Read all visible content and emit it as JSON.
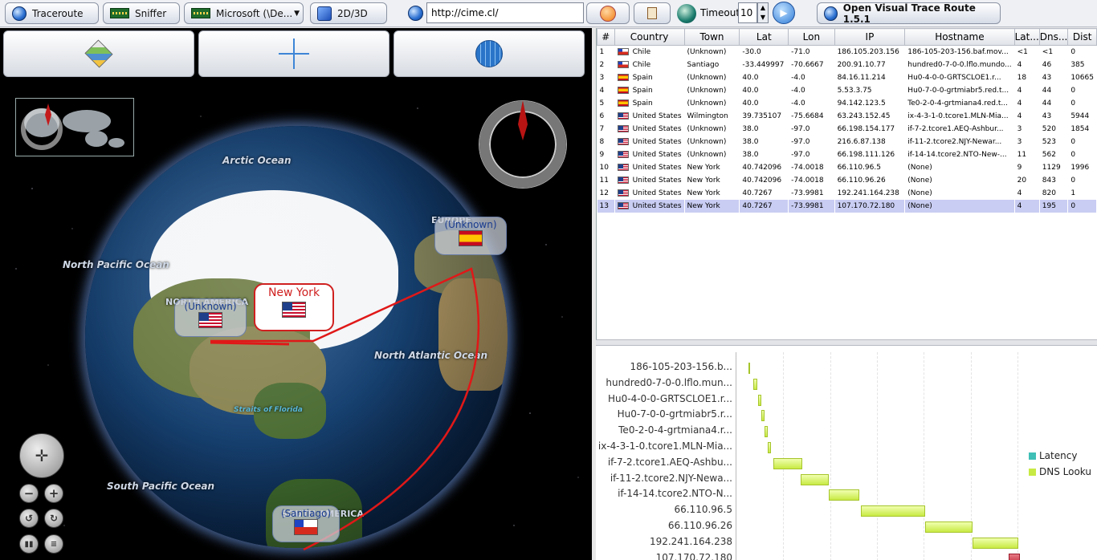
{
  "toolbar": {
    "traceroute_label": "Traceroute",
    "sniffer_label": "Sniffer",
    "interface_select": "Microsoft (\\De...",
    "view_toggle_label": "2D/3D",
    "url_value": "http://cime.cl/",
    "timeout_label": "Timeout",
    "timeout_value": "10",
    "app_title": "Open Visual Trace Route 1.5.1"
  },
  "map": {
    "ocean_labels": {
      "arctic": "Arctic Ocean",
      "north_pacific": "North Pacific Ocean",
      "north_atlantic": "North Atlantic Ocean",
      "south_pacific": "South Pacific Ocean",
      "straits": "Straits of Florida"
    },
    "region_labels": {
      "europe": "EUROPE",
      "north_america": "NORTH AMERICA",
      "south_america": "SOUTH AMERICA"
    },
    "callouts": {
      "spain": "(Unknown)",
      "us_unknown": "(Unknown)",
      "new_york": "New York",
      "santiago": "(Santiago)"
    }
  },
  "table": {
    "headers": [
      "#",
      "Country",
      "Town",
      "Lat",
      "Lon",
      "IP",
      "Hostname",
      "Lat...",
      "Dns...",
      "Dist"
    ],
    "rows": [
      {
        "n": "1",
        "country": "Chile",
        "town": "(Unknown)",
        "lat": "-30.0",
        "lon": "-71.0",
        "ip": "186.105.203.156",
        "host": "186-105-203-156.baf.mov...",
        "latency": "<1",
        "dns": "<1",
        "dist": "0"
      },
      {
        "n": "2",
        "country": "Chile",
        "town": "Santiago",
        "lat": "-33.449997",
        "lon": "-70.6667",
        "ip": "200.91.10.77",
        "host": "hundred0-7-0-0.lflo.mundo...",
        "latency": "4",
        "dns": "46",
        "dist": "385"
      },
      {
        "n": "3",
        "country": "Spain",
        "town": "(Unknown)",
        "lat": "40.0",
        "lon": "-4.0",
        "ip": "84.16.11.214",
        "host": "Hu0-4-0-0-GRTSCLOE1.r...",
        "latency": "18",
        "dns": "43",
        "dist": "10665"
      },
      {
        "n": "4",
        "country": "Spain",
        "town": "(Unknown)",
        "lat": "40.0",
        "lon": "-4.0",
        "ip": "5.53.3.75",
        "host": "Hu0-7-0-0-grtmiabr5.red.t...",
        "latency": "4",
        "dns": "44",
        "dist": "0"
      },
      {
        "n": "5",
        "country": "Spain",
        "town": "(Unknown)",
        "lat": "40.0",
        "lon": "-4.0",
        "ip": "94.142.123.5",
        "host": "Te0-2-0-4-grtmiana4.red.t...",
        "latency": "4",
        "dns": "44",
        "dist": "0"
      },
      {
        "n": "6",
        "country": "United States",
        "town": "Wilmington",
        "lat": "39.735107",
        "lon": "-75.6684",
        "ip": "63.243.152.45",
        "host": "ix-4-3-1-0.tcore1.MLN-Mia...",
        "latency": "4",
        "dns": "43",
        "dist": "5944"
      },
      {
        "n": "7",
        "country": "United States",
        "town": "(Unknown)",
        "lat": "38.0",
        "lon": "-97.0",
        "ip": "66.198.154.177",
        "host": "if-7-2.tcore1.AEQ-Ashbur...",
        "latency": "3",
        "dns": "520",
        "dist": "1854"
      },
      {
        "n": "8",
        "country": "United States",
        "town": "(Unknown)",
        "lat": "38.0",
        "lon": "-97.0",
        "ip": "216.6.87.138",
        "host": "if-11-2.tcore2.NJY-Newar...",
        "latency": "3",
        "dns": "523",
        "dist": "0"
      },
      {
        "n": "9",
        "country": "United States",
        "town": "(Unknown)",
        "lat": "38.0",
        "lon": "-97.0",
        "ip": "66.198.111.126",
        "host": "if-14-14.tcore2.NTO-New-...",
        "latency": "11",
        "dns": "562",
        "dist": "0"
      },
      {
        "n": "10",
        "country": "United States",
        "town": "New York",
        "lat": "40.742096",
        "lon": "-74.0018",
        "ip": "66.110.96.5",
        "host": "(None)",
        "latency": "9",
        "dns": "1129",
        "dist": "1996"
      },
      {
        "n": "11",
        "country": "United States",
        "town": "New York",
        "lat": "40.742096",
        "lon": "-74.0018",
        "ip": "66.110.96.26",
        "host": "(None)",
        "latency": "20",
        "dns": "843",
        "dist": "0"
      },
      {
        "n": "12",
        "country": "United States",
        "town": "New York",
        "lat": "40.7267",
        "lon": "-73.9981",
        "ip": "192.241.164.238",
        "host": "(None)",
        "latency": "4",
        "dns": "820",
        "dist": "1"
      },
      {
        "n": "13",
        "country": "United States",
        "town": "New York",
        "lat": "40.7267",
        "lon": "-73.9981",
        "ip": "107.170.72.180",
        "host": "(None)",
        "latency": "4",
        "dns": "195",
        "dist": "0"
      }
    ]
  },
  "chart_data": {
    "type": "bar",
    "categories": [
      "186-105-203-156.b...",
      "hundred0-7-0-0.lflo.mun...",
      "Hu0-4-0-0-GRTSCLOE1.r...",
      "Hu0-7-0-0-grtmiabr5.r...",
      "Te0-2-0-4-grtmiana4.r...",
      "ix-4-3-1-0.tcore1.MLN-Mia...",
      "if-7-2.tcore1.AEQ-Ashbu...",
      "if-11-2.tcore2.NJY-Newa...",
      "if-14-14.tcore2.NTO-N...",
      "66.110.96.5",
      "66.110.96.26",
      "192.241.164.238",
      "107.170.72.180"
    ],
    "series": [
      {
        "name": "Latency",
        "color": "#3fbfb6"
      },
      {
        "name": "DNS Looku",
        "color": "#c8ea44"
      }
    ],
    "start": [
      0,
      0.3,
      0.6,
      0.8,
      1.0,
      1.2,
      1.5,
      3.2,
      4.9,
      6.9,
      10.8,
      13.7,
      15.9
    ],
    "dns": [
      0.1,
      0.25,
      0.2,
      0.2,
      0.2,
      0.2,
      1.8,
      1.7,
      1.9,
      3.9,
      2.9,
      2.8,
      0.7
    ],
    "xlim": [
      0,
      17.2
    ]
  },
  "colors": {
    "selected_row": "#c9cdf3",
    "route": "#e01818"
  }
}
